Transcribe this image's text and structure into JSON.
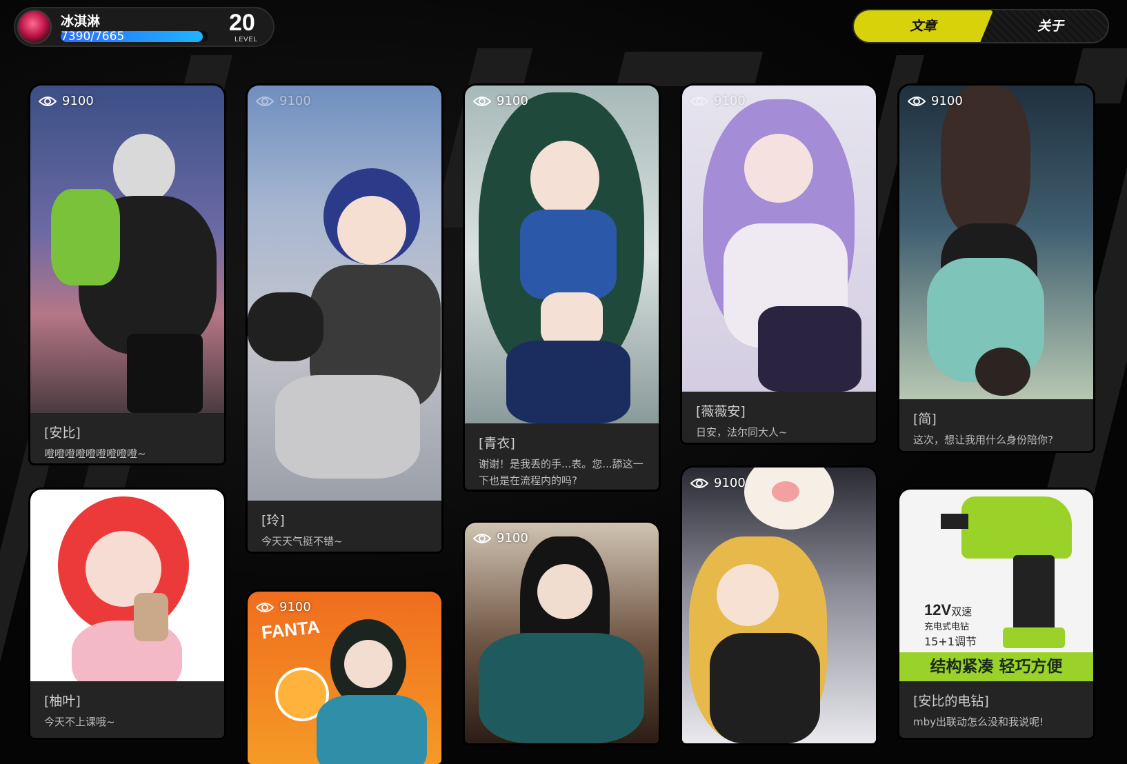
{
  "profile": {
    "username": "冰淇淋",
    "xp_text": "7390/7665",
    "xp_fraction": 0.964,
    "level": "20",
    "level_label": "LEVEL"
  },
  "nav": {
    "tabs": [
      {
        "label": "文章",
        "active": true
      },
      {
        "label": "关于",
        "active": false
      }
    ]
  },
  "cards": [
    {
      "views": "9100",
      "title": "[安比]",
      "desc": "噔噔噔噔噔噔噔噔噔~",
      "icon": "girl-with-headphones-illustration"
    },
    {
      "views": "9100",
      "title": "[玲]",
      "desc": "今天天气挺不错~",
      "icon": "girl-with-bunny-bot-illustration"
    },
    {
      "views": "9100",
      "title": "[青衣]",
      "desc": "谢谢！是我丢的手...表。您...舔这一下也是在流程内的吗?",
      "icon": "green-haired-girl-illustration"
    },
    {
      "views": "9100",
      "title": "[薇薇安]",
      "desc": "日安，法尔同大人~",
      "icon": "purple-haired-girl-illustration"
    },
    {
      "views": "9100",
      "title": "[简]",
      "desc": "这次，想让我用什么身份陪你?",
      "icon": "upside-down-girl-illustration"
    },
    {
      "views": "",
      "title": "[柚叶]",
      "desc": "今天不上课哦~",
      "icon": "red-haired-girl-with-tea-illustration"
    },
    {
      "views": "9100",
      "title": "",
      "desc": "",
      "icon": "fanta-fox-girl-illustration",
      "brand": "FANTA"
    },
    {
      "views": "9100",
      "title": "",
      "desc": "",
      "icon": "black-fox-girl-illustration"
    },
    {
      "views": "9100",
      "title": "",
      "desc": "",
      "icon": "blonde-bear-girl-illustration"
    },
    {
      "views": "",
      "title": "[安比的电钻]",
      "desc": "mby出联动怎么没和我说呢!",
      "icon": "power-drill-illustration",
      "ad": {
        "spec_line1": "12V",
        "spec_line1_suffix": "双速",
        "spec_line2": "充电式电钻",
        "spec_line3": "15+1调节",
        "banner": "结构紧凑  轻巧方便"
      }
    }
  ],
  "colors": {
    "accent": "#d7d20a",
    "xp_start": "#2b6cff",
    "xp_end": "#1fb3ff",
    "card_bg": "#242424"
  }
}
